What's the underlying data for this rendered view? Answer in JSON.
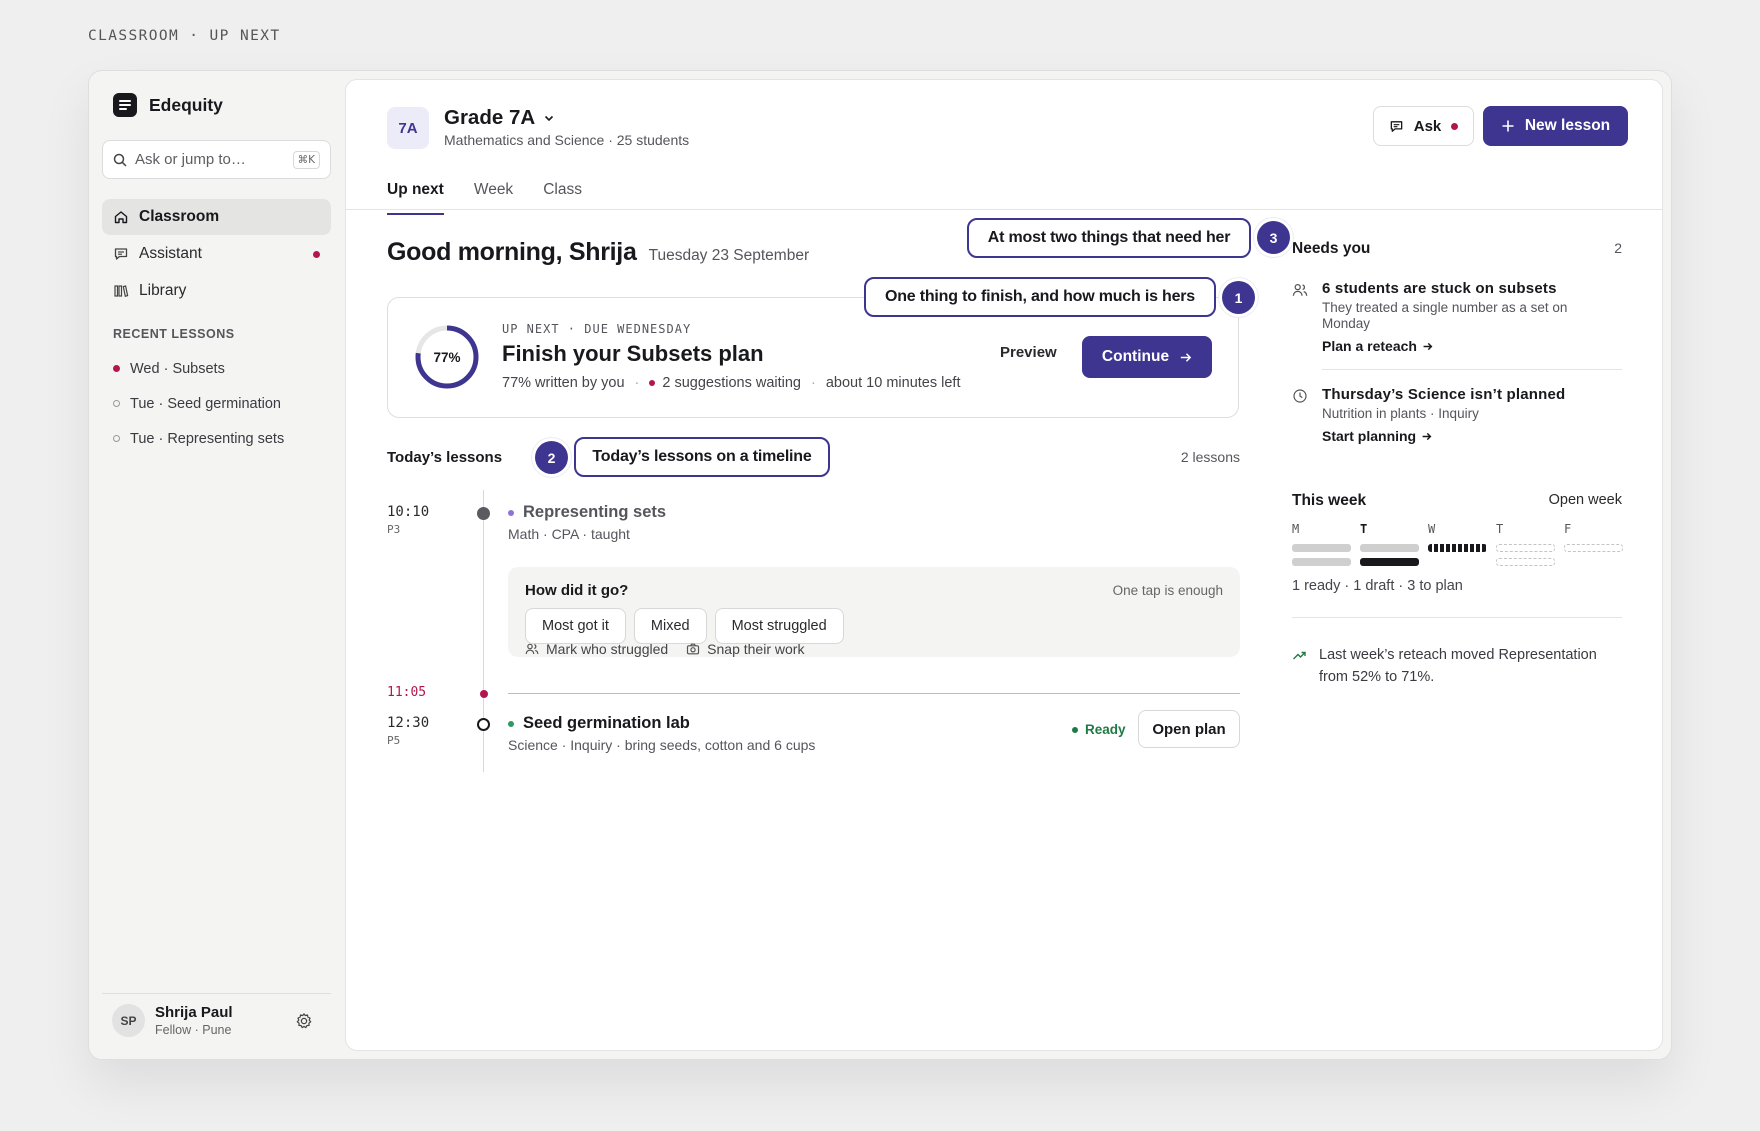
{
  "page_label": "CLASSROOM · UP NEXT",
  "brand": {
    "name": "Edequity"
  },
  "search": {
    "placeholder": "Ask or jump to…",
    "shortcut": "⌘K"
  },
  "nav": [
    {
      "label": "Classroom",
      "icon": "home-icon",
      "active": true
    },
    {
      "label": "Assistant",
      "icon": "chat-icon",
      "has_dot": true
    },
    {
      "label": "Library",
      "icon": "library-icon"
    }
  ],
  "recent": {
    "heading": "RECENT LESSONS",
    "items": [
      {
        "label": "Wed · Subsets",
        "marker": "filled"
      },
      {
        "label": "Tue · Seed germination",
        "marker": "ring"
      },
      {
        "label": "Tue · Representing sets",
        "marker": "ring"
      }
    ]
  },
  "user": {
    "initials": "SP",
    "name": "Shrija Paul",
    "role": "Fellow · Pune"
  },
  "header": {
    "badge": "7A",
    "title": "Grade 7A",
    "subtitle": "Mathematics and Science · 25 students",
    "ask_label": "Ask",
    "new_lesson_label": "New lesson"
  },
  "tabs": [
    "Up next",
    "Week",
    "Class"
  ],
  "greeting": {
    "title": "Good morning, Shrija",
    "date": "Tuesday 23 September"
  },
  "up_next": {
    "progress_pct": 77,
    "progress_label": "77%",
    "eyebrow": "UP NEXT · DUE WEDNESDAY",
    "title": "Finish your Subsets plan",
    "written": "77% written by you",
    "suggestions": "2 suggestions waiting",
    "time_left": "about 10 minutes left",
    "preview_label": "Preview",
    "continue_label": "Continue"
  },
  "lessons": {
    "heading": "Today’s lessons",
    "count": "2 lessons",
    "items": [
      {
        "time": "10:10",
        "period": "P3",
        "title": "Representing sets",
        "meta": "Math · CPA · taught",
        "dot_color": "#8f72d9"
      },
      {
        "time": "12:30",
        "period": "P5",
        "title": "Seed germination lab",
        "meta": "Science · Inquiry · bring seeds, cotton and 6 cups",
        "dot_color": "#2f9a5c",
        "status": "Ready",
        "action": "Open plan"
      }
    ],
    "feedback": {
      "question": "How did it go?",
      "hint": "One tap is enough",
      "options": [
        "Most got it",
        "Mixed",
        "Most struggled"
      ],
      "action_struggled": "Mark who struggled",
      "action_snap": "Snap their work"
    },
    "now_time": "11:05"
  },
  "needs_you": {
    "heading": "Needs you",
    "count": "2",
    "items": [
      {
        "title": "6 students are stuck on subsets",
        "desc": "They treated a single number as a set on Monday",
        "action": "Plan a reteach"
      },
      {
        "title": "Thursday’s Science isn’t planned",
        "desc": "Nutrition in plants · Inquiry",
        "action": "Start planning"
      }
    ]
  },
  "week": {
    "heading": "This week",
    "open_label": "Open week",
    "days": [
      "M",
      "T",
      "W",
      "T",
      "F"
    ],
    "summary": "1 ready · 1 draft · 3 to plan"
  },
  "insight": {
    "text": "Last week’s reteach moved Representation from 52% to 71%."
  },
  "callouts": [
    {
      "number": "3",
      "text": "At most two things that need her"
    },
    {
      "number": "1",
      "text": "One thing to finish, and how much is hers"
    },
    {
      "number": "2",
      "text": "Today’s lessons on a timeline"
    }
  ],
  "colors": {
    "accent": "#3e3591",
    "alert": "#b3164f",
    "ready": "#1f7a45"
  }
}
